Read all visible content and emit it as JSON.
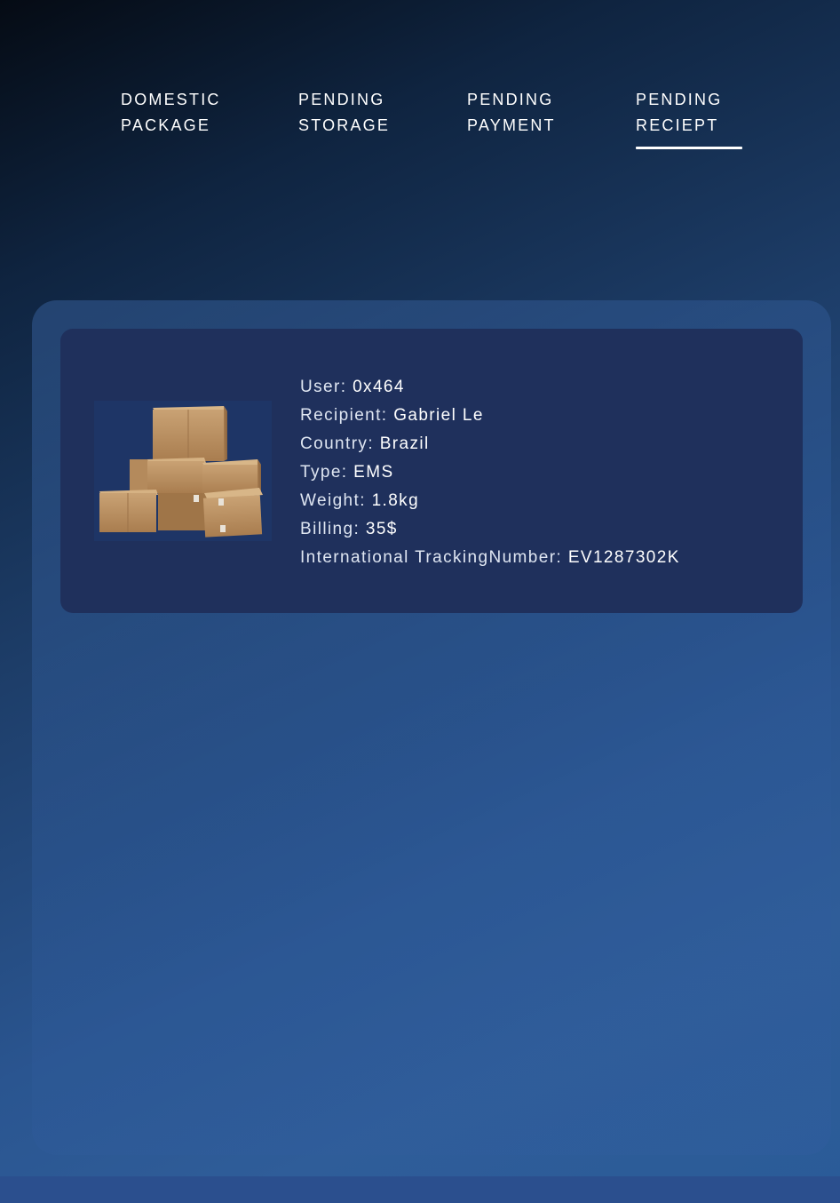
{
  "tabs": {
    "domestic": {
      "line1": "DOMESTIC",
      "line2": "PACKAGE"
    },
    "storage": {
      "line1": "PENDING",
      "line2": "STORAGE"
    },
    "payment": {
      "line1": "PENDING",
      "line2": "PAYMENT"
    },
    "receipt": {
      "line1": "PENDING",
      "line2": "RECIEPT"
    },
    "active": "receipt"
  },
  "package": {
    "image_icon": "cardboard-boxes-icon",
    "user_label": "User:",
    "user_value": "0x464",
    "recipient_label": "Recipient:",
    "recipient_value": "Gabriel Le",
    "country_label": "Country:",
    "country_value": "Brazil",
    "type_label": "Type:",
    "type_value": "EMS",
    "weight_label": "Weight:",
    "weight_value": "1.8kg",
    "billing_label": "Billing:",
    "billing_value": "35$",
    "tracking_label": "International TrackingNumber:",
    "tracking_value": "EV1287302K"
  },
  "colors": {
    "accent_underline": "#ffffff",
    "card_background": "#1f305c",
    "panel_background": "#2d5896"
  }
}
